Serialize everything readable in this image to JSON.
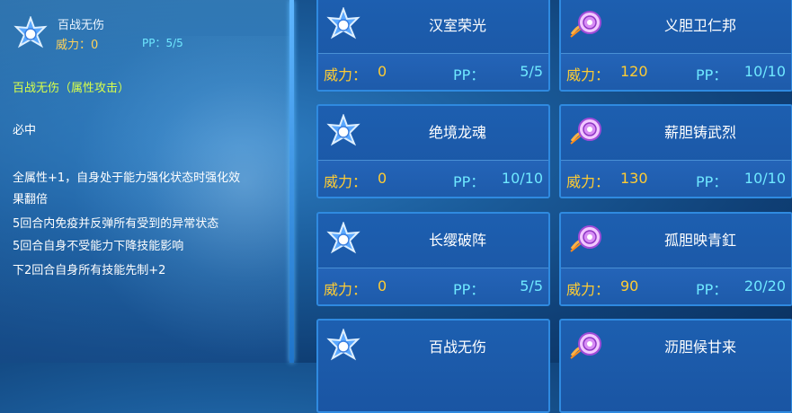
{
  "detail": {
    "icon": "star-icon",
    "name": "百战无伤",
    "power_label": "威力：",
    "power_value": "0",
    "pp": "PP：5/5",
    "type_line": "百战无伤（属性攻击）",
    "lines": [
      "必中",
      "全属性+1，自身处于能力强化状态时强化效",
      "果翻倍",
      "5回合内免疫并反弹所有受到的异常状态",
      "5回合自身不受能力下降技能影响",
      "下2回合自身所有技能先制+2"
    ]
  },
  "skills": [
    {
      "name": "汉室荣光",
      "icon": "star-icon",
      "power_label": "威力：",
      "power": "0",
      "pp_label": "PP：",
      "pp": "5/5"
    },
    {
      "name": "义胆卫仁邦",
      "icon": "shell-icon",
      "power_label": "威力：",
      "power": "120",
      "pp_label": "PP：",
      "pp": "10/10"
    },
    {
      "name": "绝境龙魂",
      "icon": "star-icon",
      "power_label": "威力：",
      "power": "0",
      "pp_label": "PP：",
      "pp": "10/10"
    },
    {
      "name": "薪胆铸武烈",
      "icon": "shell-icon",
      "power_label": "威力：",
      "power": "130",
      "pp_label": "PP：",
      "pp": "10/10"
    },
    {
      "name": "长缨破阵",
      "icon": "star-icon",
      "power_label": "威力：",
      "power": "0",
      "pp_label": "PP：",
      "pp": "5/5"
    },
    {
      "name": "孤胆映青釭",
      "icon": "shell-icon",
      "power_label": "威力：",
      "power": "90",
      "pp_label": "PP：",
      "pp": "20/20"
    },
    {
      "name": "百战无伤",
      "icon": "star-icon"
    },
    {
      "name": "沥胆候甘来",
      "icon": "shell-icon"
    }
  ]
}
